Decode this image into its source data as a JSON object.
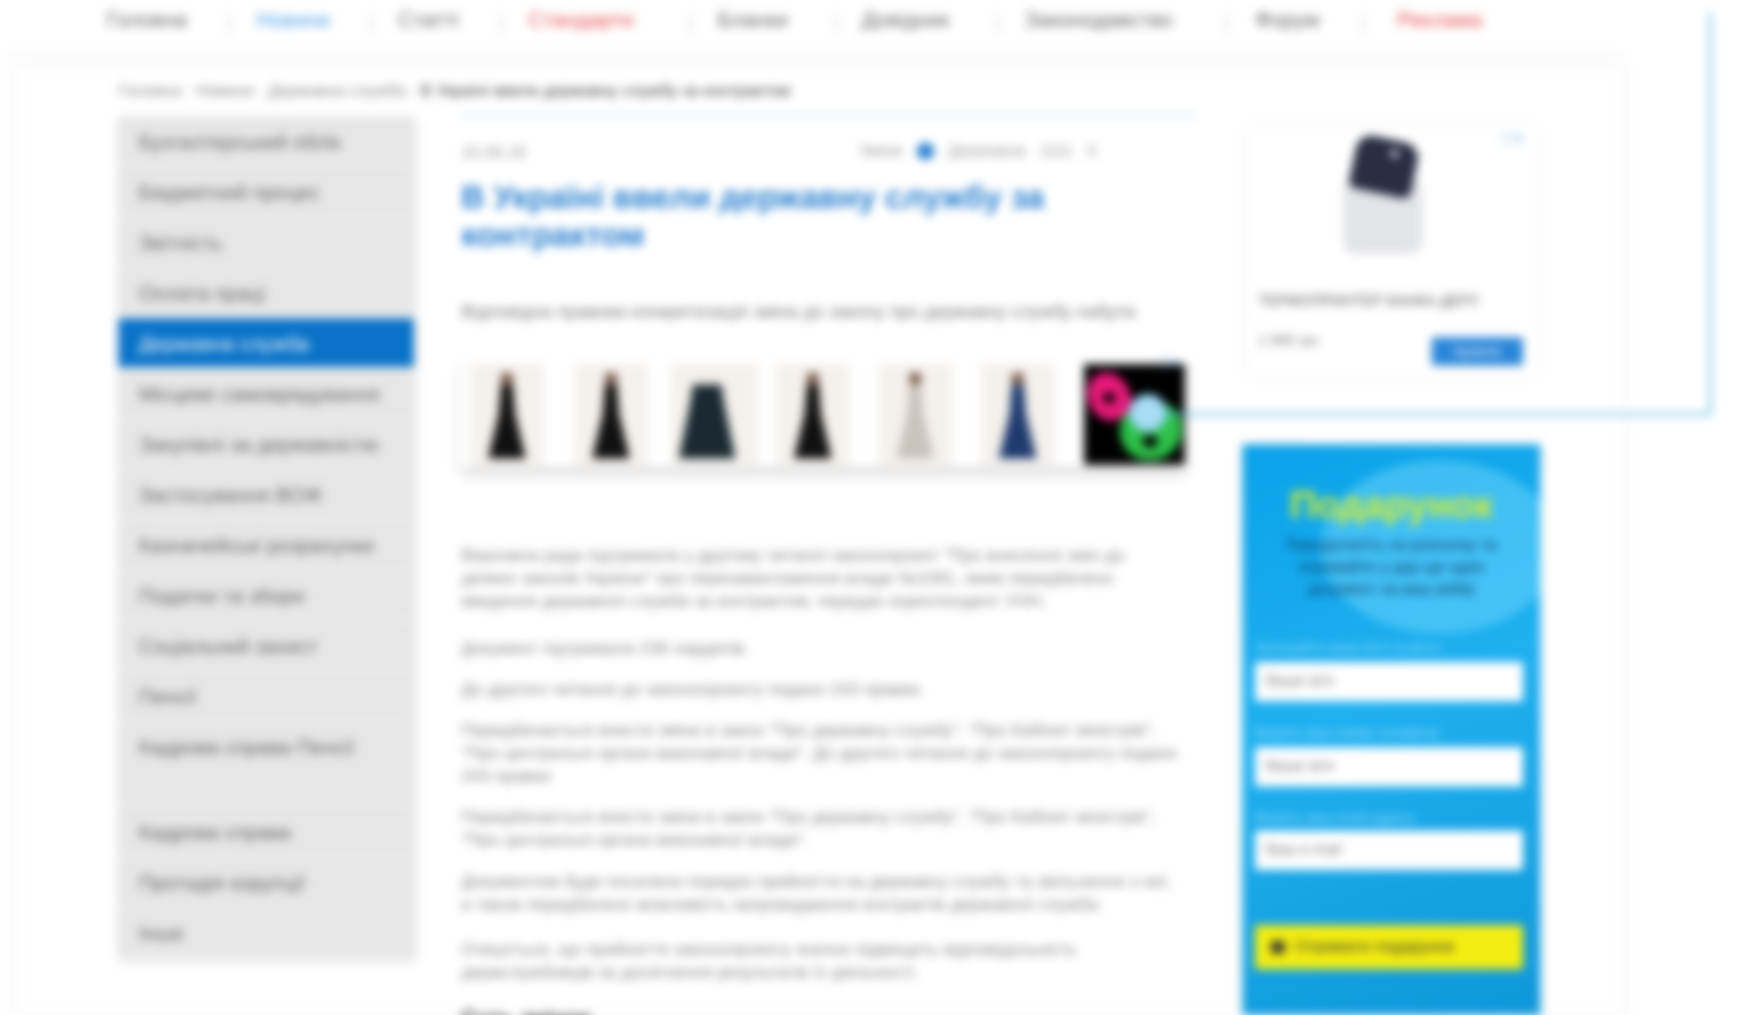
{
  "nav": {
    "items": [
      {
        "label": "Головна",
        "color": "#666666"
      },
      {
        "label": "Новини",
        "color": "#4a9ee6"
      },
      {
        "label": "Статті",
        "color": "#666666"
      },
      {
        "label": "Стандарти",
        "color": "#e65050"
      },
      {
        "label": "Бланки",
        "color": "#666666"
      },
      {
        "label": "Довідник",
        "color": "#666666"
      },
      {
        "label": "Законодавство",
        "color": "#666666"
      },
      {
        "label": "Форум",
        "color": "#666666"
      },
      {
        "label": "Реклама",
        "color": "#e65050"
      }
    ]
  },
  "breadcrumb": {
    "path": "Головна · Новини · Державна служба ·",
    "current": "В Україні ввели державну службу за контрактом"
  },
  "sidebar": {
    "items": [
      "Бухгалтерський облік",
      "Бюджетний процес",
      "Звітність",
      "Оплата праці",
      "Державна служба",
      "Місцеве самоврядування",
      "Закупівлі за державністю",
      "Застосування ВОЖ",
      "Казначейські розрахунки",
      "Податки та збори",
      "Соціальний захист",
      "Пенсії",
      "Кадрова справа Пенсії",
      "Кадрова справа",
      "Протидія корупції",
      "Інше"
    ],
    "active_index": 4
  },
  "article": {
    "date": "15.06.18",
    "meta_source": "Зміни",
    "meta_author": "Державна",
    "meta_views": "1111",
    "meta_comments": "0",
    "title": "В Україні ввели державну службу за контрактом",
    "lead": "Відповідна правова конкретизація зміна до закону про державну службу набула",
    "paragraphs": [
      "Верховна рада підтримала у другому читанні законопроект \"Про внесення змін до деяких законів України\" про перезавантаження влади №1081, яким передбачено введення державної служби за контрактом, передає кореспондент УНН.",
      "Документ підтримали 236 нардепів.",
      "До другого читання до законопроекту подано 243 правки.",
      "Передбачається внести зміни в закон \"Про державну службу\", \"Про Кабінет міністрів\", \"Про центральні органи виконавчої влади\". До другого читання до законопроекту подано 243 правки.",
      "Передбачається внести зміни в закон \"Про державну службу\", \"Про Кабінет міністрів\", \"Про центральні органи виконавчої влади\".",
      "Документом буде посилено порядок прийняття на державну службу та звільнення з неї, а також передбачено можливість запровадження контрактів державної служби.",
      "Очікується, що прийняття законопроекту значно підвищить відповідальність держслужбовців за досягнення результатів їх діяльності."
    ],
    "subhead": "Суть змінок"
  },
  "product_ad": {
    "choices_label": "ⓘ✕"
  },
  "right_ad": {
    "title": "ТЕРМОПРИНТЕР БАНКА ДЕРУ",
    "price": "1 999 грн",
    "buy_label": "Купити",
    "close_label": "ⓘ✕"
  },
  "gift": {
    "title": "Подарунок",
    "subtitle": "Передплатіть на розсилку та отримайте у дар ще один документ на ваш вибір",
    "field1_label": "Залишайте ваше ім'я та місто",
    "field1_placeholder": "Ваше ім'я",
    "field2_label": "Вкажіть ваш номер телефону",
    "field2_placeholder": "Ваше ім'я",
    "field3_label": "Вкажіть ваш email-адресу",
    "field3_placeholder": "Ваш e-mail",
    "button_label": "Отримати подарунок"
  }
}
